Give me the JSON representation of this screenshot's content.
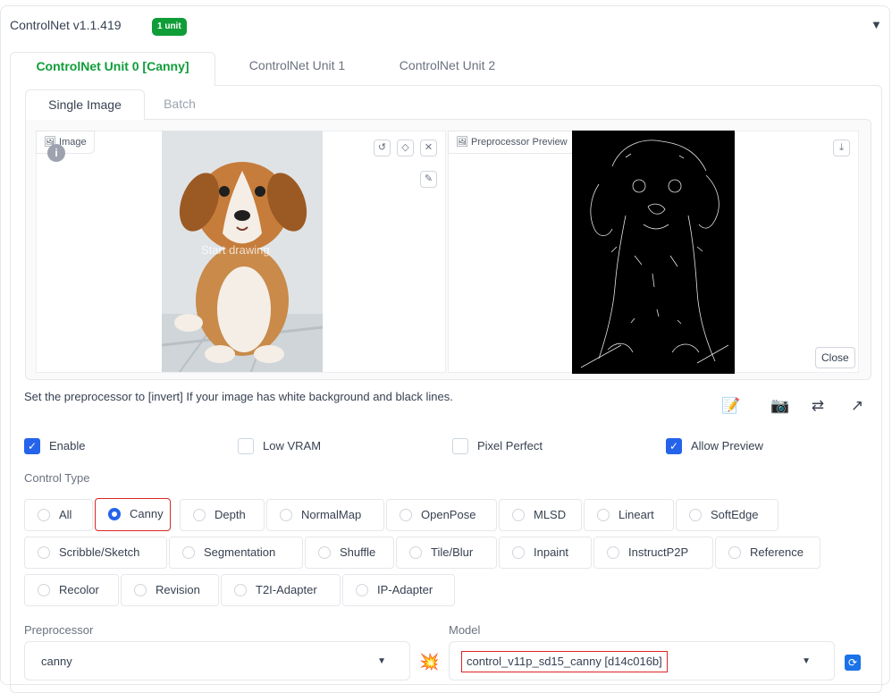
{
  "header": {
    "title": "ControlNet v1.1.419",
    "badge": "1 unit"
  },
  "unit_tabs": [
    {
      "label": "ControlNet Unit 0 [Canny]"
    },
    {
      "label": "ControlNet Unit 1"
    },
    {
      "label": "ControlNet Unit 2"
    }
  ],
  "image_tabs": [
    {
      "label": "Single Image"
    },
    {
      "label": "Batch"
    }
  ],
  "image_panel": {
    "label": "Image",
    "overlay_text": "Start drawing"
  },
  "preview_panel": {
    "label": "Preprocessor Preview",
    "close_label": "Close"
  },
  "hint": "Set the preprocessor to [invert] If your image has white background and black lines.",
  "checkboxes": [
    {
      "label": "Enable",
      "checked": true
    },
    {
      "label": "Low VRAM",
      "checked": false
    },
    {
      "label": "Pixel Perfect",
      "checked": false
    },
    {
      "label": "Allow Preview",
      "checked": true
    }
  ],
  "control_type": {
    "label": "Control Type",
    "selected": "Canny",
    "options": [
      "All",
      "Canny",
      "Depth",
      "NormalMap",
      "OpenPose",
      "MLSD",
      "Lineart",
      "SoftEdge",
      "Scribble/Sketch",
      "Segmentation",
      "Shuffle",
      "Tile/Blur",
      "Inpaint",
      "InstructP2P",
      "Reference",
      "Recolor",
      "Revision",
      "T2I-Adapter",
      "IP-Adapter"
    ]
  },
  "preprocessor": {
    "label": "Preprocessor",
    "value": "canny"
  },
  "model": {
    "label": "Model",
    "value": "control_v11p_sd15_canny [d14c016b]"
  },
  "colors": {
    "accent_green": "#0f9d38",
    "accent_blue": "#2563eb",
    "highlight_red": "#dc2626"
  },
  "icons": [
    "collapse-triangle-icon",
    "image-icon",
    "info-icon",
    "undo-icon",
    "eraser-icon",
    "close-icon",
    "brush-icon",
    "download-icon",
    "edit-icon",
    "camera-icon",
    "swap-icon",
    "send-icon",
    "explode-icon",
    "refresh-icon"
  ]
}
